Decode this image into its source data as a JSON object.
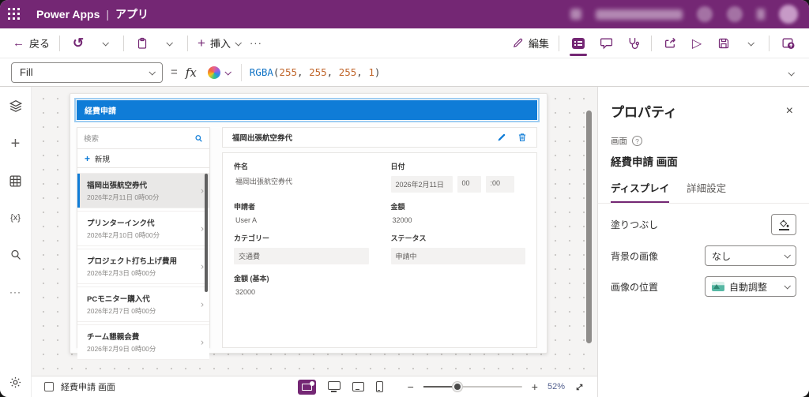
{
  "topbar": {
    "product": "Power Apps",
    "divider": "|",
    "section": "アプリ"
  },
  "cmdbar": {
    "back_arrow": "←",
    "back": "戻る",
    "undo_glyph": "↺",
    "plus": "+",
    "insert": "挿入",
    "more": "···",
    "edit": "編集",
    "play_glyph": "▷"
  },
  "formula": {
    "property": "Fill",
    "equals": "=",
    "fx": "fx",
    "code": {
      "fn": "RGBA",
      "open": "(",
      "a1": "255",
      "s1": ", ",
      "a2": "255",
      "s2": ", ",
      "a3": "255",
      "s3": ", ",
      "a4": "1",
      "close": ")"
    }
  },
  "rail": {
    "plus": "+",
    "variables": "{x}",
    "more": "···"
  },
  "canvas": {
    "app_header": "経費申請",
    "list": {
      "search_placeholder": "検索",
      "plus": "+",
      "new_label": "新規",
      "chevron": "›",
      "items": [
        {
          "title": "福岡出張航空券代",
          "date": "2026年2月11日 0時00分"
        },
        {
          "title": "プリンターインク代",
          "date": "2026年2月10日 0時00分"
        },
        {
          "title": "プロジェクト打ち上げ費用",
          "date": "2026年2月3日 0時00分"
        },
        {
          "title": "PCモニター購入代",
          "date": "2026年2月7日 0時00分"
        },
        {
          "title": "チーム懇親会費",
          "date": "2026年2月9日 0時00分"
        }
      ]
    },
    "detail": {
      "title": "福岡出張航空券代",
      "fields": {
        "subject": {
          "label": "件名",
          "value": "福岡出張航空券代"
        },
        "date": {
          "label": "日付",
          "value": "2026年2月11日",
          "hour": "00",
          "minute": ":00"
        },
        "applicant": {
          "label": "申請者",
          "value": "User A"
        },
        "amount": {
          "label": "金額",
          "value": "32000"
        },
        "category": {
          "label": "カテゴリー",
          "value": "交通費"
        },
        "status": {
          "label": "ステータス",
          "value": "申請中"
        },
        "amount_base": {
          "label": "金額 (基本)",
          "value": "32000"
        }
      }
    }
  },
  "props": {
    "title": "プロパティ",
    "close": "×",
    "element_type": "画面",
    "help": "?",
    "element_name": "経費申請 画面",
    "tabs": {
      "display": "ディスプレイ",
      "advanced": "詳細設定"
    },
    "rows": {
      "fill": {
        "label": "塗りつぶし"
      },
      "bg_image": {
        "label": "背景の画像",
        "value": "なし"
      },
      "image_position": {
        "label": "画像の位置",
        "value": "自動調整"
      }
    }
  },
  "bottom": {
    "screen_label": "経費申請 画面",
    "minus": "−",
    "plus": "+",
    "zoom_level": "52%"
  },
  "colors": {
    "brand_purple": "#742774",
    "accent_blue": "#0f7cd7",
    "formula_fn": "#1173c5",
    "formula_num": "#c0652a"
  }
}
